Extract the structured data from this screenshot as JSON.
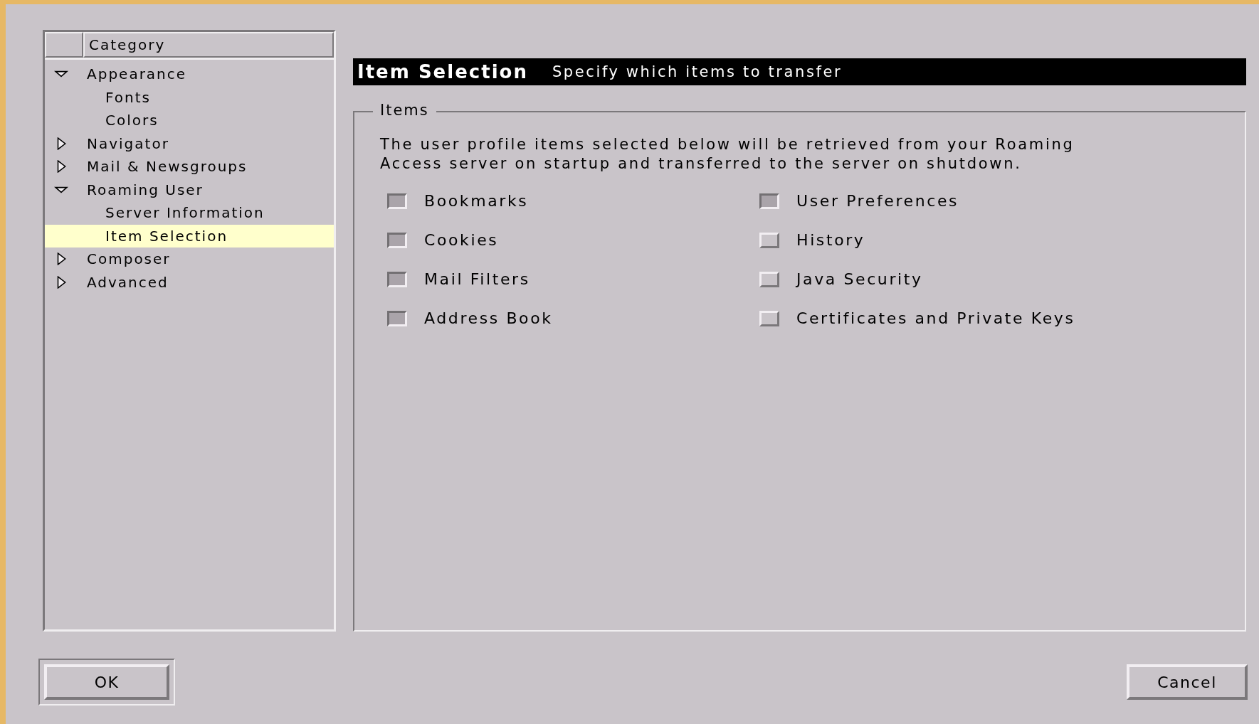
{
  "tree": {
    "header": "Category",
    "items": [
      {
        "label": "Appearance",
        "expanded": true,
        "selected": false,
        "children": [
          {
            "label": "Fonts",
            "selected": false
          },
          {
            "label": "Colors",
            "selected": false
          }
        ]
      },
      {
        "label": "Navigator",
        "expanded": false,
        "selected": false
      },
      {
        "label": "Mail & Newsgroups",
        "expanded": false,
        "selected": false
      },
      {
        "label": "Roaming User",
        "expanded": true,
        "selected": false,
        "children": [
          {
            "label": "Server Information",
            "selected": false
          },
          {
            "label": "Item Selection",
            "selected": true
          }
        ]
      },
      {
        "label": "Composer",
        "expanded": false,
        "selected": false
      },
      {
        "label": "Advanced",
        "expanded": false,
        "selected": false
      }
    ]
  },
  "panel": {
    "title": "Item Selection",
    "subtitle": "Specify which items to transfer",
    "group_label": "Items",
    "description": "The user profile items selected below will be retrieved from your Roaming Access server on startup and transferred to the server on shutdown.",
    "items": [
      {
        "label": "Bookmarks",
        "checked": true
      },
      {
        "label": "User Preferences",
        "checked": true
      },
      {
        "label": "Cookies",
        "checked": true
      },
      {
        "label": "History",
        "checked": false
      },
      {
        "label": "Mail Filters",
        "checked": true
      },
      {
        "label": "Java Security",
        "checked": false
      },
      {
        "label": "Address Book",
        "checked": true
      },
      {
        "label": "Certificates and Private Keys",
        "checked": false
      }
    ]
  },
  "buttons": [
    {
      "label": "OK",
      "default": true
    },
    {
      "label": "Cancel",
      "default": false
    }
  ]
}
